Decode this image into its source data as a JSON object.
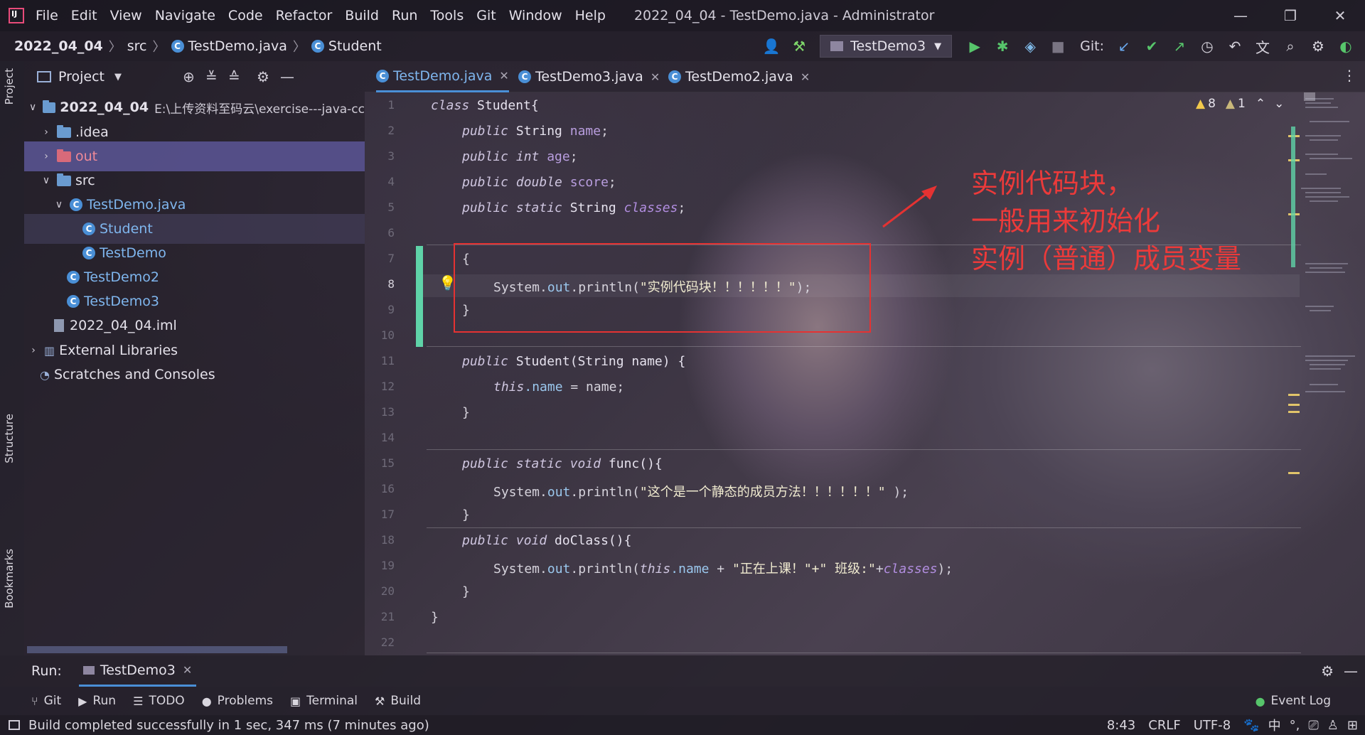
{
  "menubar": {
    "items": [
      "File",
      "Edit",
      "View",
      "Navigate",
      "Code",
      "Refactor",
      "Build",
      "Run",
      "Tools",
      "Git",
      "Window",
      "Help"
    ],
    "window_title": "2022_04_04 - TestDemo.java - Administrator",
    "minimize": "—",
    "restore": "❐",
    "close": "✕"
  },
  "navbar": {
    "crumbs": [
      "2022_04_04",
      "src",
      "TestDemo.java",
      "Student"
    ],
    "run_config": "TestDemo3",
    "git_label": "Git:"
  },
  "left_stripe": {
    "project": "Project",
    "structure": "Structure",
    "bookmarks": "Bookmarks"
  },
  "project_panel": {
    "title": "Project",
    "root": "2022_04_04",
    "root_path": "E:\\上传资料至码云\\exercise---java-cc",
    "items": [
      ".idea",
      "out",
      "src",
      "TestDemo.java",
      "Student",
      "TestDemo",
      "TestDemo2",
      "TestDemo3",
      "2022_04_04.iml",
      "External Libraries",
      "Scratches and Consoles"
    ]
  },
  "editor": {
    "tabs": [
      "TestDemo.java",
      "TestDemo3.java",
      "TestDemo2.java"
    ],
    "warnings_count": "8",
    "weak_warnings_count": "1",
    "line_numbers": [
      "1",
      "2",
      "3",
      "4",
      "5",
      "6",
      "7",
      "8",
      "9",
      "10",
      "11",
      "12",
      "13",
      "14",
      "15",
      "16",
      "17",
      "18",
      "19",
      "20",
      "21",
      "22"
    ],
    "code": {
      "l1_kw": "class",
      "l1_name": " Student{",
      "l2_kw": "public",
      "l2_type": " String ",
      "l2_field": "name",
      "l2_end": ";",
      "l3_kw": "public",
      "l3_type": " int ",
      "l3_field": "age",
      "l3_end": ";",
      "l4_kw": "public",
      "l4_type": " double ",
      "l4_field": "score",
      "l4_end": ";",
      "l5_kw": "public static",
      "l5_type": " String ",
      "l5_field": "classes",
      "l5_end": ";",
      "l7": "{",
      "l8_a": "System.",
      "l8_out": "out",
      "l8_b": ".println(",
      "l8_str": "\"实例代码块！！！！！！\"",
      "l8_end": ");",
      "l9": "}",
      "l11_kw": "public",
      "l11_rest": " Student(String name) {",
      "l12_kw": "this",
      "l12_field": ".name",
      "l12_rest": " = name;",
      "l13": "}",
      "l15_kw": "public static void",
      "l15_rest": " func(){",
      "l16_a": "System.",
      "l16_out": "out",
      "l16_b": ".println(",
      "l16_str": "\"这个是一个静态的成员方法！！！！！！\"",
      "l16_end": " );",
      "l17": "}",
      "l18_kw": "public void",
      "l18_rest": " doClass(){",
      "l19_a": "System.",
      "l19_out": "out",
      "l19_b": ".println(",
      "l19_this": "this",
      "l19_field": ".name",
      "l19_plus": " + ",
      "l19_str": "\"正在上课！\"+\" 班级:\"",
      "l19_plus2": "+",
      "l19_cls": "classes",
      "l19_end": ");",
      "l20": "}",
      "l21": "}"
    },
    "annotation": [
      "实例代码块，",
      "一般用来初始化",
      "实例（普通）成员变量"
    ]
  },
  "run_panel": {
    "label": "Run:",
    "tab": "TestDemo3"
  },
  "bottom_tabs": [
    "Git",
    "Run",
    "TODO",
    "Problems",
    "Terminal",
    "Build"
  ],
  "event_log": "Event Log",
  "statusbar": {
    "message": "Build completed successfully in 1 sec, 347 ms (7 minutes ago)",
    "position": "8:43",
    "line_sep": "CRLF",
    "encoding": "UTF-8",
    "ime": "中"
  },
  "colors": {
    "accent_blue": "#4a8fd6",
    "annotation_red": "#e53232",
    "vcs_green": "#5fd3a8",
    "selection": "#5c5696"
  }
}
